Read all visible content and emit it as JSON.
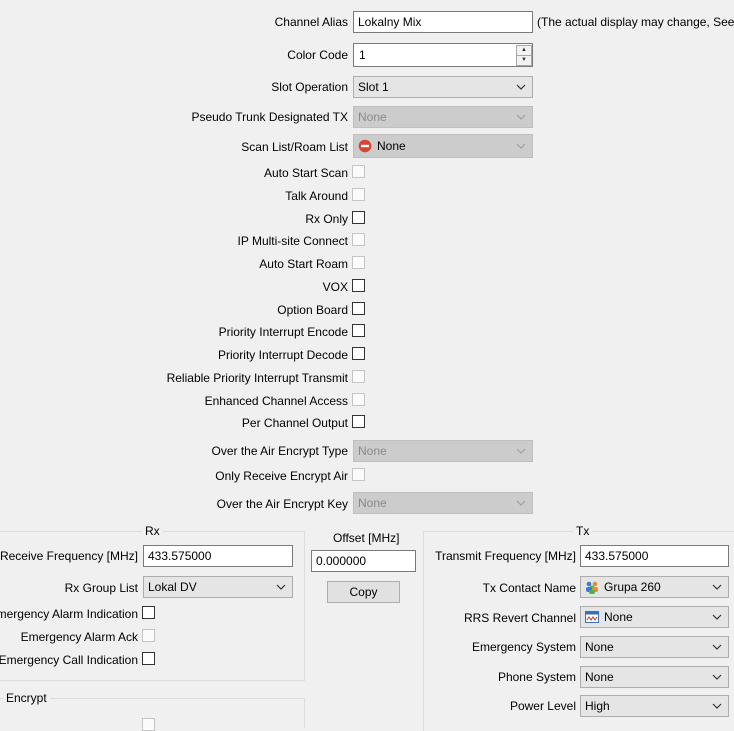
{
  "channel": {
    "alias_label": "Channel Alias",
    "alias_value": "Lokalny Mix",
    "alias_note": "(The actual display may change, See the",
    "color_code_label": "Color Code",
    "color_code_value": "1",
    "slot_operation_label": "Slot Operation",
    "slot_operation_value": "Slot 1",
    "pseudo_trunk_label": "Pseudo Trunk Designated TX",
    "pseudo_trunk_value": "None",
    "scan_list_label": "Scan List/Roam List",
    "scan_list_value": "None",
    "checkboxes": [
      {
        "label": "Auto Start Scan",
        "enabled": false,
        "checked": false
      },
      {
        "label": "Talk Around",
        "enabled": false,
        "checked": false
      },
      {
        "label": "Rx Only",
        "enabled": true,
        "checked": false
      },
      {
        "label": "IP Multi-site Connect",
        "enabled": false,
        "checked": false
      },
      {
        "label": "Auto Start Roam",
        "enabled": false,
        "checked": false
      },
      {
        "label": "VOX",
        "enabled": true,
        "checked": false
      },
      {
        "label": "Option Board",
        "enabled": true,
        "checked": false
      },
      {
        "label": "Priority Interrupt Encode",
        "enabled": true,
        "checked": false
      },
      {
        "label": "Priority Interrupt Decode",
        "enabled": true,
        "checked": false
      },
      {
        "label": "Reliable Priority Interrupt Transmit",
        "enabled": false,
        "checked": false
      },
      {
        "label": "Enhanced Channel Access",
        "enabled": false,
        "checked": false
      },
      {
        "label": "Per Channel Output",
        "enabled": true,
        "checked": false
      }
    ],
    "ota_encrypt_type_label": "Over the Air Encrypt Type",
    "ota_encrypt_type_value": "None",
    "only_receive_encrypt_label": "Only Receive Encrypt Air",
    "ota_encrypt_key_label": "Over the Air Encrypt Key",
    "ota_encrypt_key_value": "None"
  },
  "rx": {
    "title": "Rx",
    "freq_label": "Receive Frequency [MHz]",
    "freq_value": "433.575000",
    "group_list_label": "Rx Group List",
    "group_list_value": "Lokal DV",
    "emergency_alarm_indication_label": "Emergency Alarm Indication",
    "emergency_alarm_ack_label": "Emergency Alarm Ack",
    "emergency_call_indication_label": "Emergency Call Indication"
  },
  "offset": {
    "label": "Offset [MHz]",
    "value": "0.000000",
    "copy_label": "Copy"
  },
  "tx": {
    "title": "Tx",
    "freq_label": "Transmit Frequency [MHz]",
    "freq_value": "433.575000",
    "contact_label": "Tx Contact Name",
    "contact_value": "Grupa 260",
    "rrs_label": "RRS Revert Channel",
    "rrs_value": "None",
    "emergency_system_label": "Emergency System",
    "emergency_system_value": "None",
    "phone_system_label": "Phone System",
    "phone_system_value": "None",
    "power_level_label": "Power Level",
    "power_level_value": "High"
  },
  "encrypt": {
    "title": "Encrypt"
  },
  "colors": {
    "window_bg": "#f0f0f0",
    "disabled_combo": "#cccccc",
    "enabled_combo": "#e5e5e5",
    "none_icon_red": "#d9432f"
  }
}
